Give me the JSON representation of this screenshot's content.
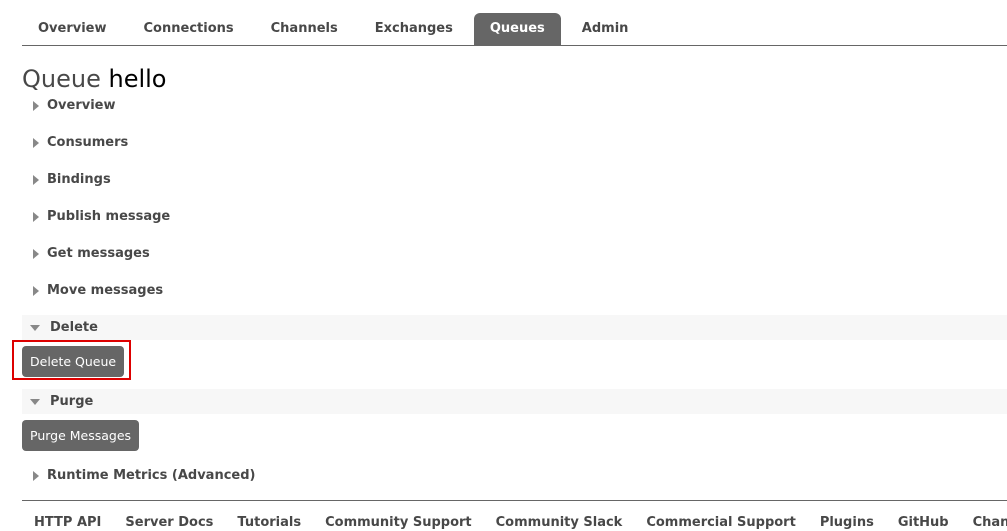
{
  "nav": {
    "tabs": [
      {
        "label": "Overview",
        "active": false
      },
      {
        "label": "Connections",
        "active": false
      },
      {
        "label": "Channels",
        "active": false
      },
      {
        "label": "Exchanges",
        "active": false
      },
      {
        "label": "Queues",
        "active": true
      },
      {
        "label": "Admin",
        "active": false
      }
    ]
  },
  "page": {
    "title_prefix": "Queue",
    "title_name": "hello"
  },
  "sections": [
    {
      "label": "Overview",
      "expanded": false
    },
    {
      "label": "Consumers",
      "expanded": false
    },
    {
      "label": "Bindings",
      "expanded": false
    },
    {
      "label": "Publish message",
      "expanded": false
    },
    {
      "label": "Get messages",
      "expanded": false
    },
    {
      "label": "Move messages",
      "expanded": false
    },
    {
      "label": "Delete",
      "expanded": true
    },
    {
      "label": "Purge",
      "expanded": true
    },
    {
      "label": "Runtime Metrics (Advanced)",
      "expanded": false
    }
  ],
  "buttons": {
    "delete_queue": "Delete Queue",
    "purge_messages": "Purge Messages"
  },
  "footer": {
    "links": [
      "HTTP API",
      "Server Docs",
      "Tutorials",
      "Community Support",
      "Community Slack",
      "Commercial Support",
      "Plugins",
      "GitHub",
      "Changelog"
    ]
  },
  "colors": {
    "accent": "#666666",
    "highlight": "#dd0000",
    "text": "#484848",
    "expanded_bg": "#f7f7f7"
  }
}
